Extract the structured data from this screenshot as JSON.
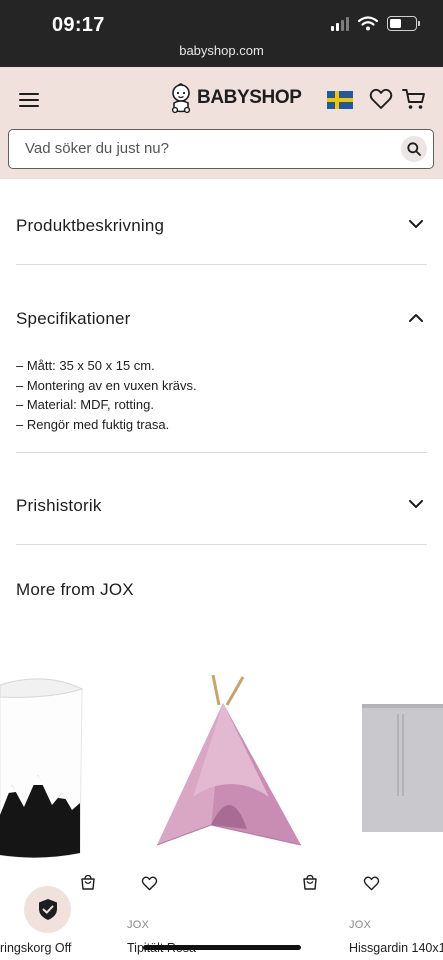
{
  "status_bar": {
    "time": "09:17",
    "url": "babyshop.com"
  },
  "header": {
    "logo_text": "BABYSHOP",
    "search_placeholder": "Vad söker du just nu?"
  },
  "accordions": [
    {
      "title": "Produktbeskrivning",
      "expanded": false
    },
    {
      "title": "Specifikationer",
      "expanded": true,
      "items": [
        "– Mått: 35 x 50 x 15 cm.",
        "– Montering av en vuxen krävs.",
        "– Material: MDF, rotting.",
        "– Rengör med fuktig trasa."
      ]
    },
    {
      "title": "Prishistorik",
      "expanded": false
    }
  ],
  "more_from": {
    "title": "More from JOX",
    "products": [
      {
        "brand": "",
        "name": "ringskorg Off"
      },
      {
        "brand": "JOX",
        "name": "Tipitält Rosa"
      },
      {
        "brand": "JOX",
        "name": "Hissgardin 140x1"
      }
    ]
  },
  "colors": {
    "header_bg": "#f1e1dd",
    "status_bg": "#252525",
    "tent_pink": "#d9a6c4",
    "divider": "#dadada"
  },
  "icons": [
    "menu-icon",
    "logo-baby-icon",
    "swedish-flag-icon",
    "heart-icon",
    "cart-icon",
    "search-icon",
    "chevron-down-icon",
    "chevron-up-icon",
    "add-to-cart-icon",
    "wishlist-icon",
    "shield-icon"
  ]
}
